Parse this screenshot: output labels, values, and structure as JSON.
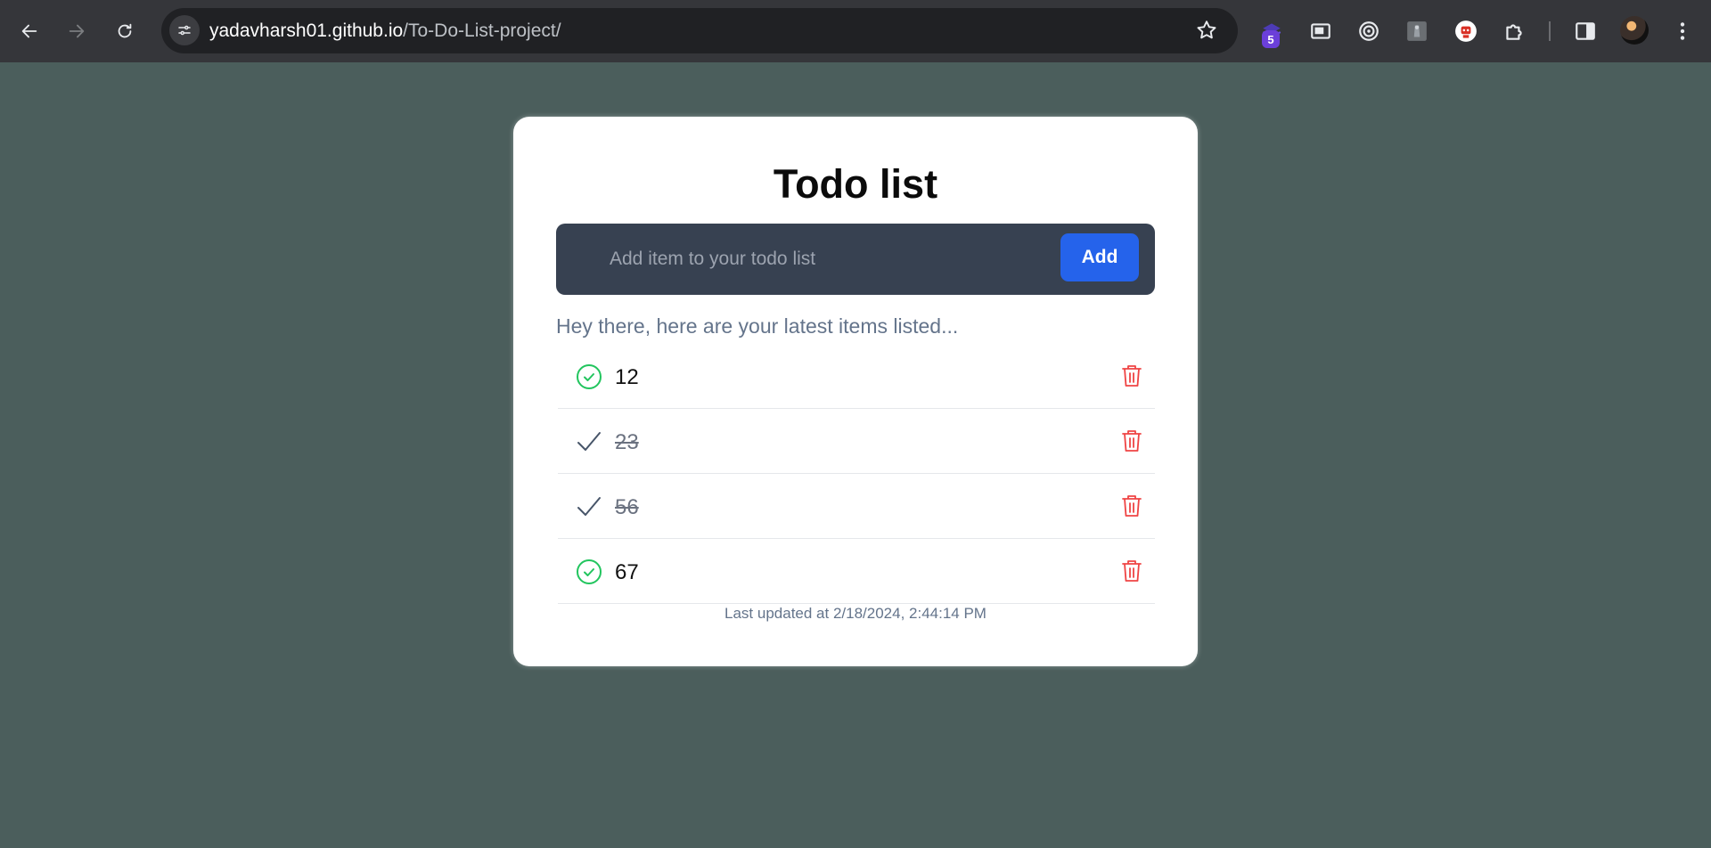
{
  "browser": {
    "url_host": "yadavharsh01.github.io",
    "url_path": "/To-Do-List-project/",
    "extension_badge": "5"
  },
  "app": {
    "title": "Todo list",
    "input_placeholder": "Add item to your todo list",
    "input_value": "",
    "add_label": "Add",
    "greeting": "Hey there, here are your latest items listed...",
    "items": [
      {
        "text": "12",
        "done": false
      },
      {
        "text": "23",
        "done": true
      },
      {
        "text": "56",
        "done": true
      },
      {
        "text": "67",
        "done": false
      }
    ],
    "footer": "Last updated at 2/18/2024, 2:44:14 PM"
  },
  "colors": {
    "page_bg": "#4b5e5c",
    "input_bar": "#374151",
    "accent": "#2563eb",
    "check_green": "#22c55e",
    "trash_red": "#ef4444"
  }
}
